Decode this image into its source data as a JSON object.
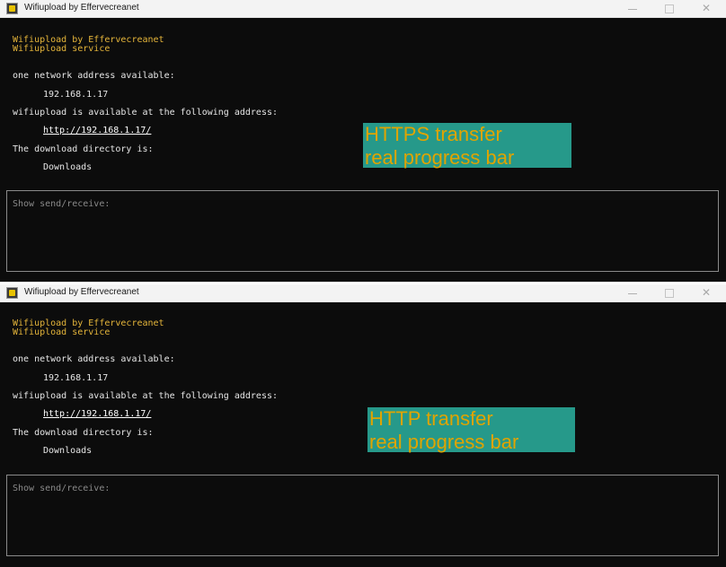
{
  "windows": [
    {
      "title": "Wifiupload by Effervecreanet",
      "header_line1": "Wifiupload by Effervecreanet",
      "header_line2": "Wifiupload service",
      "network_label": "one network address available:",
      "ip": "192.168.1.17",
      "available_label": "wifiupload is available at the following address:",
      "url": "http://192.168.1.17/",
      "dir_label": "The download directory is:",
      "dir": "Downloads",
      "badge_line1": "HTTPS transfer",
      "badge_line2": "real progress bar",
      "panel_label": "Show send/receive:"
    },
    {
      "title": "Wifiupload by Effervecreanet",
      "header_line1": "Wifiupload by Effervecreanet",
      "header_line2": "Wifiupload service",
      "network_label": "one network address available:",
      "ip": "192.168.1.17",
      "available_label": "wifiupload is available at the following address:",
      "url": "http://192.168.1.17/",
      "dir_label": "The download directory is:",
      "dir": "Downloads",
      "badge_line1": "HTTP transfer",
      "badge_line2": "real progress bar",
      "panel_label": "Show send/receive:"
    }
  ],
  "controls": {
    "minimize_icon": "minimize-icon",
    "maximize_icon": "maximize-icon",
    "close_icon": "close-icon",
    "close_glyph": "✕"
  },
  "colors": {
    "console_bg": "#0c0c0c",
    "header_text": "#e5b53a",
    "badge_bg": "#26998a",
    "badge_text": "#e0a400"
  }
}
